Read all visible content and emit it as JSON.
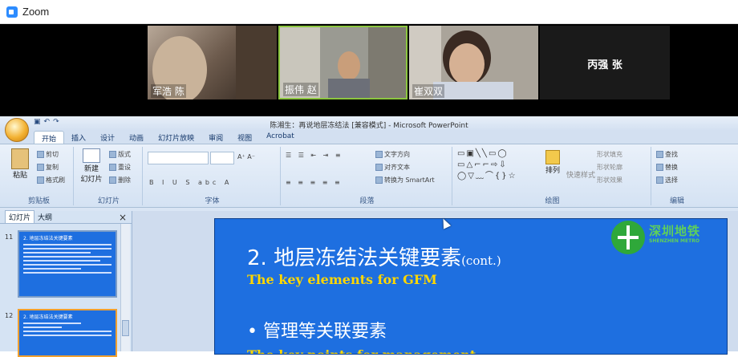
{
  "window": {
    "title": "Zoom"
  },
  "participants": [
    {
      "name": "军浩 陈",
      "video": true,
      "active": false
    },
    {
      "name": "振伟 赵",
      "video": true,
      "active": true
    },
    {
      "name": "崔双双",
      "video": true,
      "active": false
    },
    {
      "name": "丙强 张",
      "video": false,
      "active": false
    }
  ],
  "ppt": {
    "window_title": "陈湘生：再说地层冻结法 [兼容模式] - Microsoft PowerPoint",
    "tabs": [
      "开始",
      "插入",
      "设计",
      "动画",
      "幻灯片放映",
      "审阅",
      "视图",
      "Acrobat"
    ],
    "selected_tab": "开始",
    "groups": {
      "clipboard": {
        "label": "剪贴板",
        "paste": "粘贴",
        "cut": "剪切",
        "copy": "复制",
        "format_painter": "格式刷"
      },
      "slides": {
        "label": "幻灯片",
        "new_slide": "新建",
        "new_slide2": "幻灯片",
        "layout": "版式",
        "reset": "重设",
        "delete": "删除"
      },
      "font": {
        "label": "字体"
      },
      "paragraph": {
        "label": "段落",
        "text_direction": "文字方向",
        "align_text": "对齐文本",
        "smartart": "转换为 SmartArt"
      },
      "drawing": {
        "label": "绘图",
        "arrange": "排列",
        "quick_styles": "快速样式",
        "shape_fill": "形状填充",
        "shape_outline": "形状轮廓",
        "shape_effects": "形状效果"
      },
      "editing": {
        "label": "编辑",
        "find": "查找",
        "replace": "替换",
        "select": "选择"
      }
    },
    "sidebar": {
      "tabs": [
        "幻灯片",
        "大纲"
      ],
      "selected_tab": "幻灯片",
      "close": "×",
      "slides": [
        {
          "number": "11",
          "title": "2. 地层冻结法关键要素"
        },
        {
          "number": "12",
          "title": "2. 地层冻结法关键要素"
        }
      ]
    },
    "slide": {
      "logo_text": "深圳地铁",
      "logo_sub": "SHENZHEN METRO",
      "title": "2. 地层冻结法关键要素",
      "title_suffix": "(cont.)",
      "subtitle": "The key elements for GFM",
      "bullet": "• 管理等关联要素",
      "bullet_en": "The key points for management"
    }
  },
  "colors": {
    "slide_bg": "#1e6fe0",
    "subtitle": "#ffd700",
    "active_border": "#8cc63f"
  }
}
